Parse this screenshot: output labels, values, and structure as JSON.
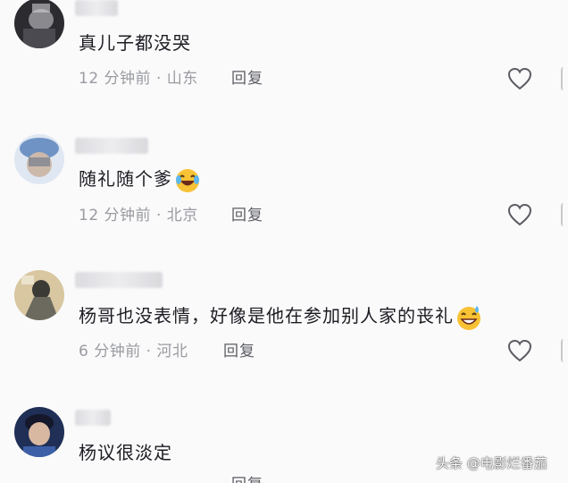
{
  "comments": [
    {
      "text": "真儿子都没哭",
      "time": "12 分钟前",
      "sep": "·",
      "location": "山东",
      "reply_label": "回复",
      "emoji": "",
      "avatar_color": "#3a3a3f"
    },
    {
      "text": "随礼随个爹",
      "time": "12 分钟前",
      "sep": "·",
      "location": "北京",
      "reply_label": "回复",
      "emoji": "laughing-tears",
      "avatar_color": "#7a9bc8"
    },
    {
      "text": "杨哥也没表情，好像是他在参加别人家的丧礼",
      "time": "6 分钟前",
      "sep": "·",
      "location": "河北",
      "reply_label": "回复",
      "emoji": "grinning-sweat",
      "avatar_color": "#c9b28a"
    },
    {
      "text": "杨议很淡定",
      "time": "",
      "sep": "",
      "location": "",
      "reply_label": "回复",
      "emoji": "",
      "avatar_color": "#2c3f66"
    }
  ],
  "watermark": "头条 @电影烂番茄",
  "colors": {
    "background": "#fafafb",
    "text": "#161823",
    "meta": "#9a9ba0",
    "reply": "#5c5d63",
    "emoji_yellow": "#f7c234"
  }
}
